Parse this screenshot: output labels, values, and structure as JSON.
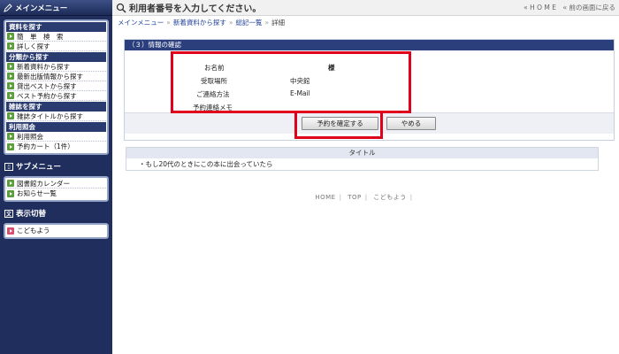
{
  "sidebar": {
    "header": "メインメニュー",
    "groups": [
      {
        "title": "資料を探す",
        "items": [
          "簡　単　検　索",
          "詳しく探す"
        ]
      },
      {
        "title": "分類から探す",
        "items": [
          "新着資料から探す",
          "最新出版情報から探す",
          "貸出ベストから探す",
          "ベスト予約から探す"
        ]
      },
      {
        "title": "雑誌を探す",
        "items": [
          "雑誌タイトルから探す"
        ]
      },
      {
        "title": "利用照会",
        "items": [
          "利用照会",
          "予約カート（1件）"
        ]
      }
    ],
    "sub_title": "サブメニュー",
    "sub_items": [
      "図書館カレンダー",
      "お知らせ一覧"
    ],
    "display_title": "表示切替",
    "display_items": [
      "こどもよう"
    ]
  },
  "topbar": {
    "title": "利用者番号を入力してください。",
    "links": "« H O M E　« 前の画面に戻る"
  },
  "breadcrumb": {
    "items": [
      "メインメニュー",
      "新着資料から探す",
      "総記一覧"
    ],
    "current": "詳細"
  },
  "confirm": {
    "heading": "（３）情報の確認",
    "name_label": "お名前",
    "name_suffix": "様",
    "pickup_label": "受取場所",
    "pickup_value": "中央館",
    "contact_label": "ご連絡方法",
    "contact_value": "E-Mail",
    "memo_label": "予約連絡メモ",
    "confirm_button": "予約を確定する",
    "cancel_button": "やめる"
  },
  "results": {
    "column": "タイトル",
    "rows": [
      "・もし20代のときにこの本に出会っていたら"
    ]
  },
  "footer": {
    "links": [
      "HOME",
      "TOP",
      "こどもよう"
    ]
  },
  "colors": {
    "sidebar_bg": "#1f2e5c",
    "highlight_red": "#e0001b",
    "accent_green": "#5a9d3a"
  }
}
